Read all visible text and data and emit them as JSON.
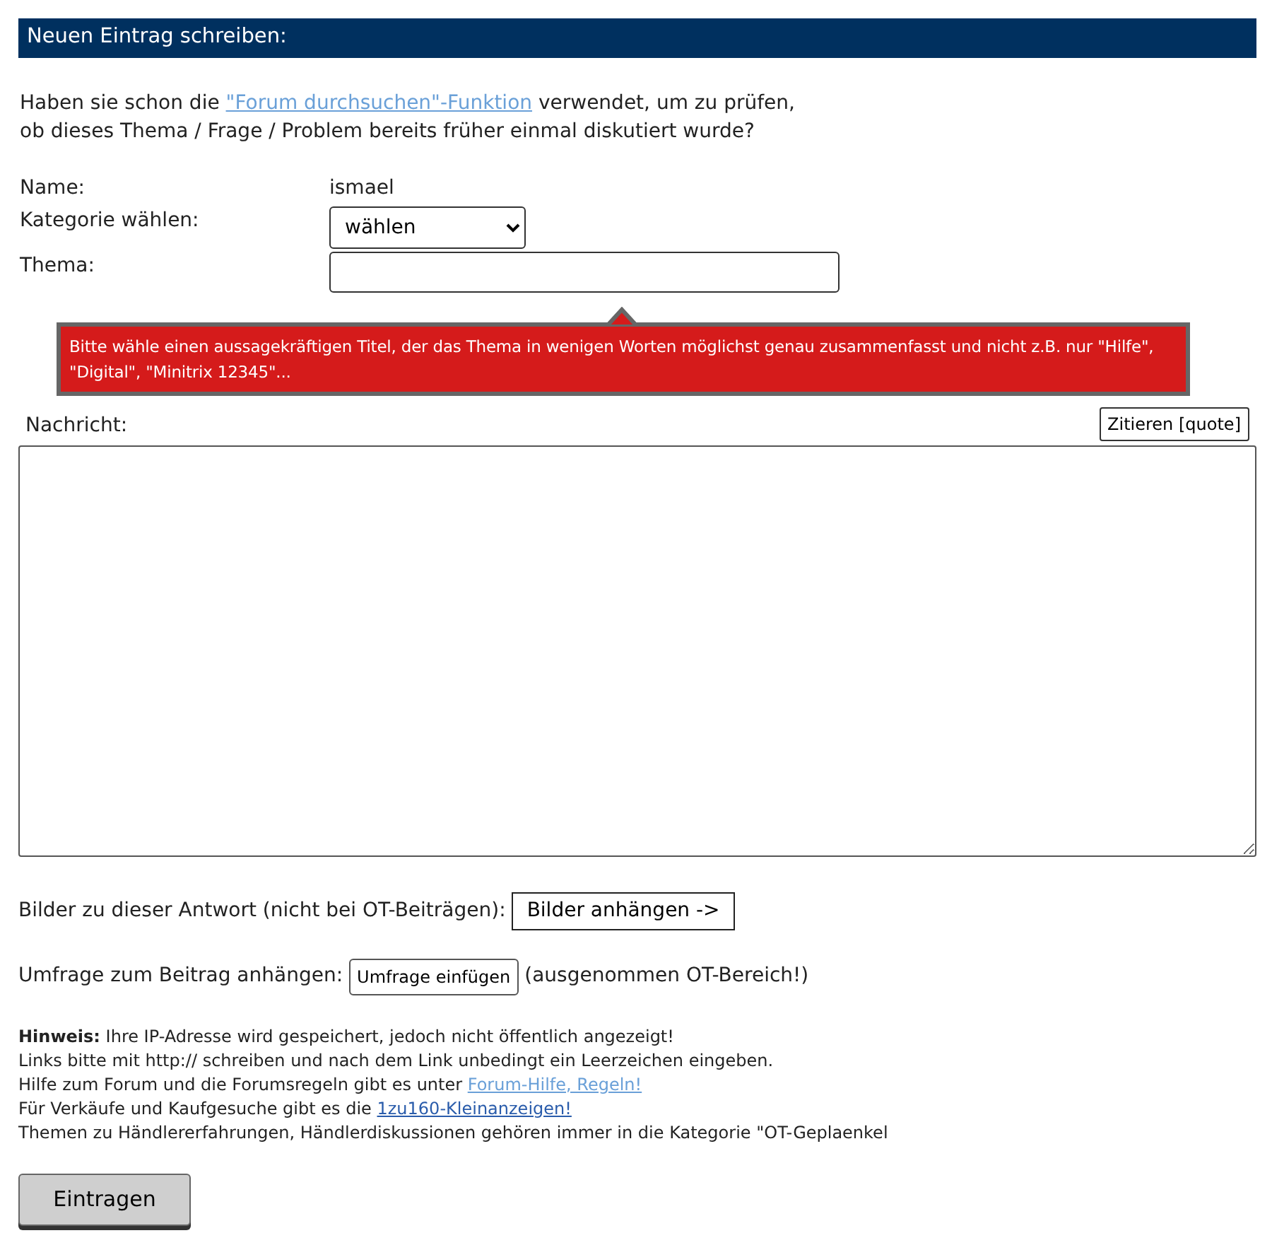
{
  "header": {
    "title": "Neuen Eintrag schreiben:"
  },
  "intro": {
    "before": "Haben sie schon die ",
    "link": {
      "text": "\"Forum durchsuchen\"-Funktion",
      "visited": false
    },
    "after": " verwendet, um zu prüfen,\nob dieses Thema / Frage / Problem bereits früher einmal diskutiert wurde?"
  },
  "form": {
    "name_label": "Name:",
    "name_value": "ismael",
    "category_label": "Kategorie wählen:",
    "category_value": "wählen",
    "topic_label": "Thema:"
  },
  "tooltip": {
    "text": "Bitte wähle einen aussagekräftigen Titel, der das Thema in wenigen Worten möglichst genau zusammenfasst und nicht z.B. nur \"Hilfe\", \"Digital\", \"Minitrix 12345\"..."
  },
  "message": {
    "label": "Nachricht:",
    "quote_button": "Zitieren [quote]"
  },
  "images": {
    "label": "Bilder zu dieser Antwort (nicht bei OT-Beiträgen):",
    "button": "Bilder anhängen ->"
  },
  "poll": {
    "label": "Umfrage zum Beitrag anhängen:",
    "button": "Umfrage einfügen",
    "note": "(ausgenommen OT-Bereich!)"
  },
  "notes": [
    {
      "text": "**Hinweis:** Ihre IP-Adresse wird gespeichert, jedoch nicht öffentlich angezeigt!"
    },
    {
      "text": "Links bitte mit http:// schreiben und nach dem Link unbedingt ein Leerzeichen eingeben."
    },
    {
      "text": "Hilfe zum Forum und die Forumsregeln gibt es unter ",
      "link": {
        "text": "Forum-Hilfe, Regeln!",
        "visited": false
      }
    },
    {
      "text": "Für Verkäufe und Kaufgesuche gibt es die ",
      "link": {
        "text": "1zu160-Kleinanzeigen!",
        "visited": true
      }
    },
    {
      "text": "Themen zu Händlererfahrungen, Händlerdiskussionen gehören immer in die Kategorie \"OT-Geplaenkel"
    }
  ],
  "submit": {
    "label": "Eintragen"
  }
}
